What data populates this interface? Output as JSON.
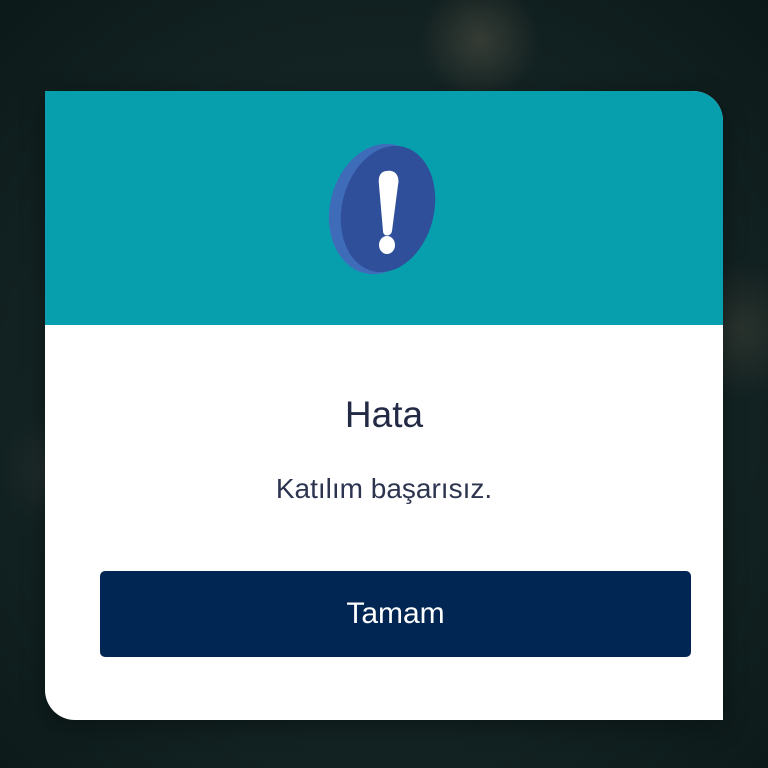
{
  "dialog": {
    "title": "Hata",
    "message": "Katılım başarısız.",
    "confirm_label": "Tamam",
    "icon": "exclamation-icon",
    "header_color": "#079fae",
    "button_color": "#022653"
  }
}
